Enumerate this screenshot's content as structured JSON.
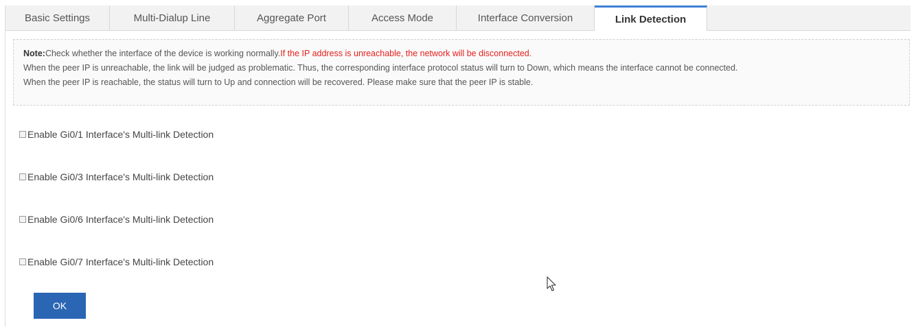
{
  "tabs": [
    {
      "label": "Basic Settings",
      "active": false
    },
    {
      "label": "Multi-Dialup Line",
      "active": false
    },
    {
      "label": "Aggregate Port",
      "active": false
    },
    {
      "label": "Access Mode",
      "active": false
    },
    {
      "label": "Interface Conversion",
      "active": false
    },
    {
      "label": "Link Detection",
      "active": true
    }
  ],
  "note": {
    "label": "Note:",
    "line1_text": "Check whether the interface of the device is working normally.",
    "line1_warning": "If the IP address is unreachable, the network will be disconnected.",
    "line2": "When the peer IP is unreachable, the link will be judged as problematic. Thus, the corresponding interface protocol status will turn to Down, which means the interface cannot be connected.",
    "line3": "When the peer IP is reachable, the status will turn to Up and connection will be recovered. Please make sure that the peer IP is stable."
  },
  "options": [
    {
      "label": "Enable Gi0/1 Interface's Multi-link Detection",
      "checked": false
    },
    {
      "label": "Enable Gi0/3 Interface's Multi-link Detection",
      "checked": false
    },
    {
      "label": "Enable Gi0/6 Interface's Multi-link Detection",
      "checked": false
    },
    {
      "label": "Enable Gi0/7 Interface's Multi-link Detection",
      "checked": false
    }
  ],
  "ok_label": "OK",
  "colors": {
    "accent": "#3b7fd6",
    "warning": "#e6201e",
    "button": "#2a66b3"
  }
}
